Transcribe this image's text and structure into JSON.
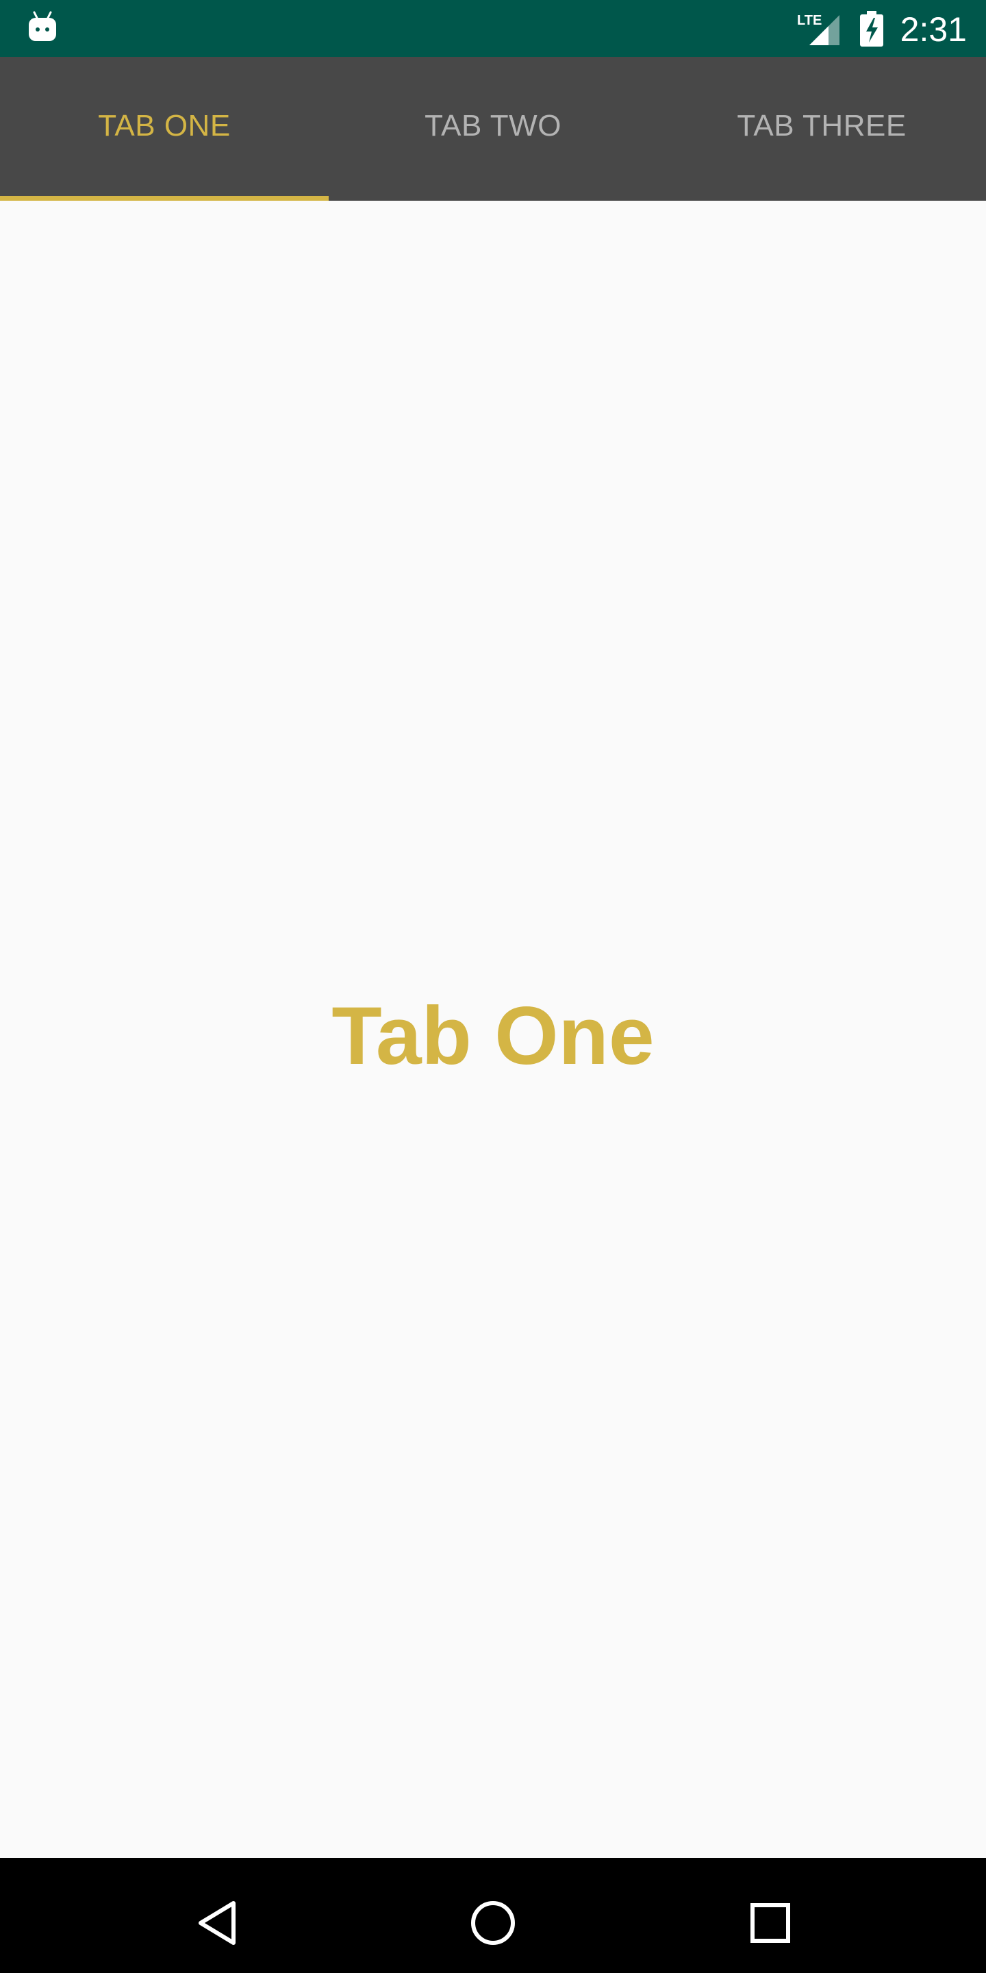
{
  "status_bar": {
    "time": "2:31",
    "network_label": "LTE",
    "icons": [
      "android-robot-icon",
      "lte-signal-icon",
      "battery-charging-icon"
    ]
  },
  "tabs": [
    {
      "label": "TAB ONE",
      "selected": true
    },
    {
      "label": "TAB TWO",
      "selected": false
    },
    {
      "label": "TAB THREE",
      "selected": false
    }
  ],
  "content": {
    "heading": "Tab One"
  },
  "nav_bar": {
    "icons": [
      "back-icon",
      "home-icon",
      "recents-icon"
    ]
  },
  "colors": {
    "status_bar": "#00574b",
    "tab_bar": "#484848",
    "accent": "#d4b545",
    "tab_inactive_text": "#b3b3b3",
    "background": "#fafafa",
    "nav_bar": "#000000"
  }
}
